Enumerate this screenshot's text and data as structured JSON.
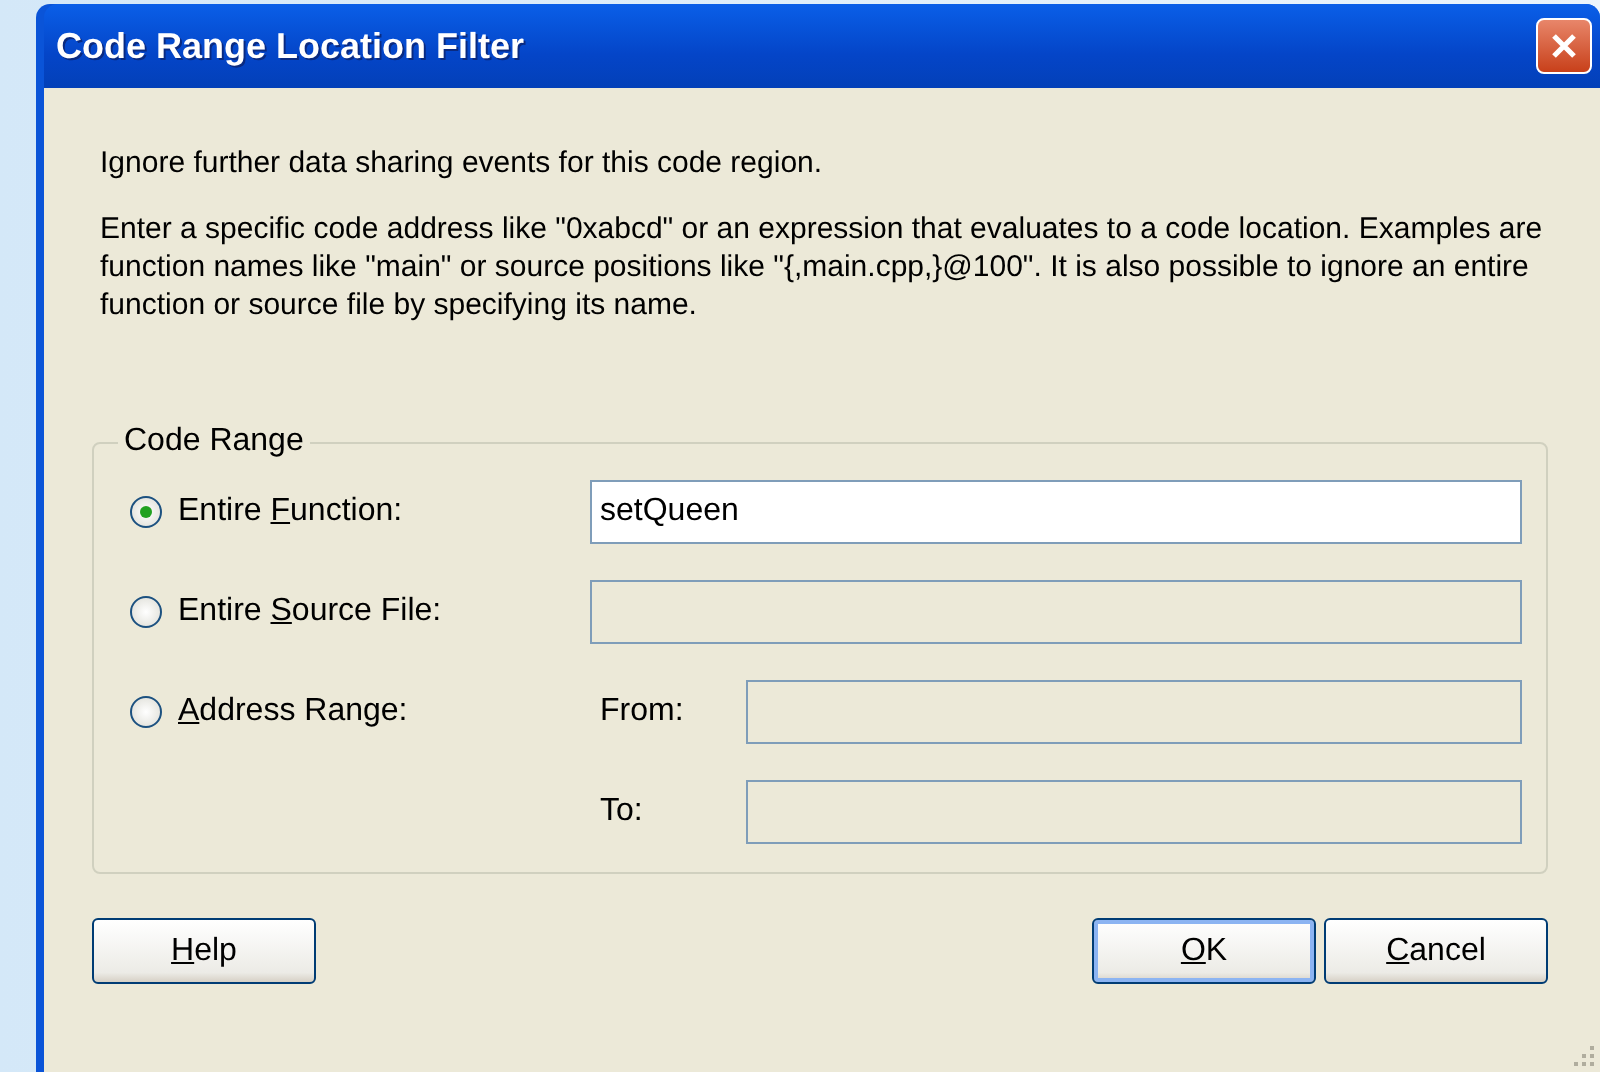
{
  "window": {
    "title": "Code Range Location Filter"
  },
  "intro": "Ignore further data sharing events for this code region.",
  "description": "Enter a specific code address like \"0xabcd\" or an expression that evaluates to a code location. Examples are function names like \"main\" or source positions like \"{,main.cpp,}@100\". It is also possible to ignore an entire function or source file by specifying its name.",
  "group": {
    "title": "Code Range",
    "options": [
      {
        "kind": "single",
        "label_pre": "Entire ",
        "access_key": "F",
        "label_post": "unction:",
        "selected": true,
        "value": "setQueen"
      },
      {
        "kind": "single",
        "label_pre": "Entire ",
        "access_key": "S",
        "label_post": "ource File:",
        "selected": false
      },
      {
        "kind": "range",
        "access_key": "A",
        "label_post": "ddress Range:",
        "selected": false,
        "from_label": "From:",
        "to_label": "To:"
      }
    ]
  },
  "buttons": [
    {
      "kind": "help",
      "access_key": "H",
      "label_post": "elp",
      "default": false
    },
    {
      "kind": "action",
      "access_key": "O",
      "label_post": "K",
      "default": true
    },
    {
      "kind": "action",
      "access_key": "C",
      "label_post": "ancel",
      "default": false
    }
  ]
}
